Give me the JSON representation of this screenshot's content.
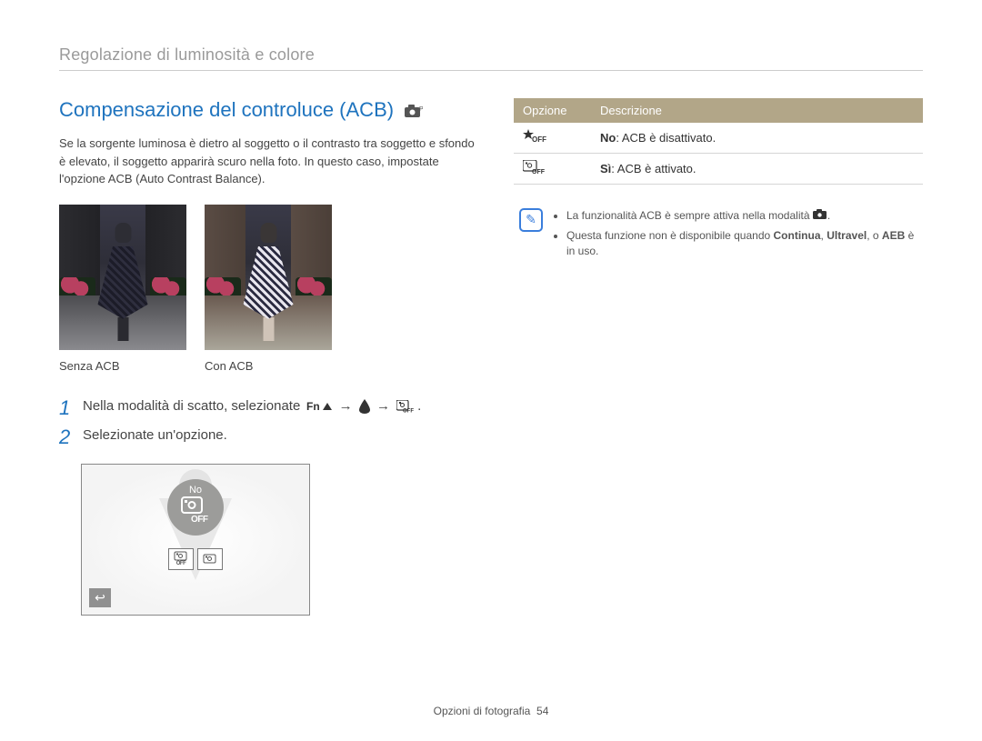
{
  "running_head": "Regolazione di luminosità e colore",
  "heading": "Compensazione del controluce (ACB)",
  "heading_mode_icon": "camera-mode-p-icon",
  "intro": "Se la sorgente luminosa è dietro al soggetto o il contrasto tra soggetto e sfondo è elevato, il soggetto apparirà scuro nella foto. In questo caso, impostate l'opzione ACB (Auto Contrast Balance).",
  "photos": {
    "left_caption": "Senza ACB",
    "right_caption": "Con ACB"
  },
  "steps": [
    {
      "num": "1",
      "text_prefix": "Nella modalità di scatto, selezionate ",
      "icons": [
        "fn-up-icon",
        "arrow-right-icon",
        "drop-icon",
        "arrow-right-icon",
        "acb-off-icon"
      ],
      "text_suffix": "."
    },
    {
      "num": "2",
      "text_prefix": "Selezionate un'opzione.",
      "icons": [],
      "text_suffix": ""
    }
  ],
  "screen": {
    "badge_label": "No",
    "badge_icon_text": "OFF",
    "chiclets": [
      {
        "top_icon": "acb-glyph",
        "bot": "OFF"
      },
      {
        "top_icon": "acb-glyph",
        "bot": ""
      }
    ],
    "back_glyph": "↩"
  },
  "options_table": {
    "head_option": "Opzione",
    "head_desc": "Descrizione",
    "rows": [
      {
        "icon": "star-off-icon",
        "bold": "No",
        "text": ": ACB è disattivato."
      },
      {
        "icon": "acb-off-icon",
        "bold": "Sì",
        "text": ": ACB è attivato."
      }
    ]
  },
  "note": {
    "bullets": [
      {
        "pre": "La funzionalità ACB è sempre attiva nella modalità ",
        "icon": "camera-icon",
        "post": "."
      },
      {
        "pre": "Questa funzione non è disponibile quando ",
        "bold1": "Continua",
        "mid": ", ",
        "bold2": "Ultravel",
        "post2": ", o ",
        "bold3": "AEB",
        "post3": " è in uso."
      }
    ]
  },
  "footer_section": "Opzioni di fotografia",
  "footer_page": "54"
}
